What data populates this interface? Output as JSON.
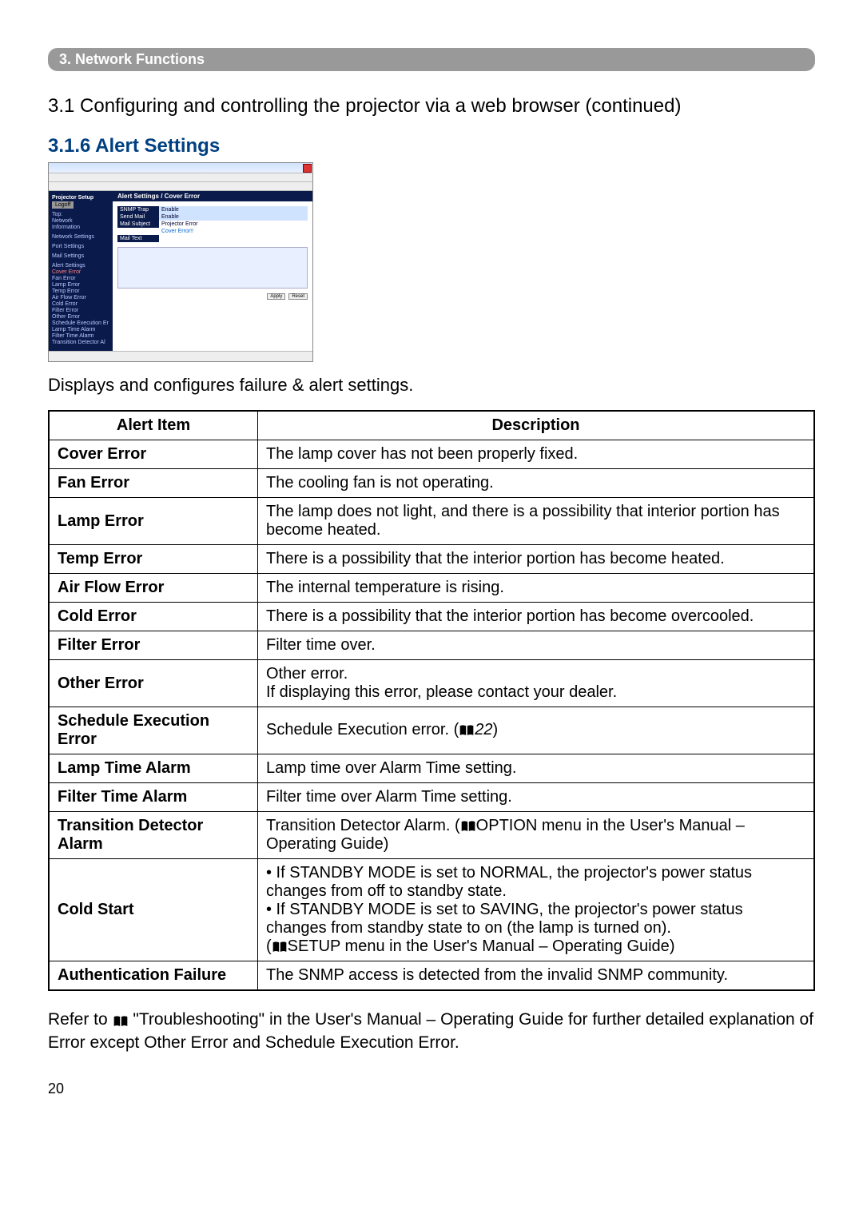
{
  "chapter_bar": "3. Network Functions",
  "section_title": "3.1 Conﬁguring and controlling the projector via a web browser (continued)",
  "heading": "3.1.6 Alert Settings",
  "screenshot": {
    "header": "Alert Settings / Cover Error",
    "side_top_label": "Projector Setup",
    "side_gray": "Logoff",
    "side_links": [
      "Top:",
      "Network",
      "Information",
      "",
      "Network Settings",
      "",
      "Port Settings",
      "",
      "Mail Settings",
      "",
      "Alert Settings"
    ],
    "side_alerts": [
      "Cover Error",
      "Fan Error",
      "Lamp Error",
      "Temp Error",
      "Air Flow Error",
      "Cold Error",
      "Filter Error",
      "Other Error",
      "Schedule Execution Er",
      "Lamp Time Alarm",
      "Filter Time Alarm",
      "Transition Detector Al"
    ],
    "row1": {
      "label": "SNMP Trap",
      "value": "Enable"
    },
    "row2": {
      "label": "Send Mail",
      "value": "Enable"
    },
    "row3": {
      "label": "Mail Subject",
      "value": "Projector Error"
    },
    "row4": {
      "label": "",
      "value": "Cover Error!!"
    },
    "row5": {
      "label": "Mail Text",
      "value": ""
    },
    "btn_apply": "Apply",
    "btn_reset": "Reset"
  },
  "intro": "Displays and configures failure & alert settings.",
  "table_headers": {
    "item": "Alert Item",
    "desc": "Description"
  },
  "rows": [
    {
      "item": "Cover Error",
      "desc": "The lamp cover has not been properly fixed."
    },
    {
      "item": "Fan Error",
      "desc": "The cooling fan is not operating."
    },
    {
      "item": "Lamp Error",
      "desc": "The lamp does not light, and there is a possibility that interior portion has become heated."
    },
    {
      "item": "Temp Error",
      "desc": "There is a possibility that the interior portion has become heated."
    },
    {
      "item": "Air Flow Error",
      "desc": "The internal temperature is rising."
    },
    {
      "item": "Cold Error",
      "desc": "There is a possibility that the interior portion has become overcooled."
    },
    {
      "item": "Filter Error",
      "desc": "Filter time over."
    },
    {
      "item": "Other Error",
      "desc_pre": "Other error.",
      "desc_post": "If displaying this error, please contact your dealer."
    },
    {
      "item": "Schedule Execution Error",
      "desc_pre": "Schedule Execution error. (",
      "ref": "22",
      "desc_post": ")"
    },
    {
      "item": "Lamp Time Alarm",
      "desc": "Lamp time over Alarm Time setting."
    },
    {
      "item": "Filter Time Alarm",
      "desc": "Filter time over Alarm Time setting."
    },
    {
      "item": "Transition Detector Alarm",
      "desc_pre": "Transition Detector Alarm. (",
      "ref": "OPTION menu in the User's Manual – Operating Guide",
      "desc_post": ")"
    },
    {
      "item": "Cold Start",
      "l1": "• If STANDBY MODE is set to NORMAL, the projector's power status changes from off to standby state.",
      "l2": "• If STANDBY MODE is set to SAVING, the projector's power status changes from standby state to on (the lamp is turned on).",
      "ref": "SETUP menu in the User's Manual – Operating Guide"
    },
    {
      "item": "Authentication Failure",
      "desc": "The SNMP access is detected from the invalid SNMP community."
    }
  ],
  "footer": {
    "pre": "Refer to ",
    "ref": "\"Troubleshooting\" in the User's Manual – Operating Guide",
    "post": " for further detailed explanation of Error except Other Error and Schedule Execution Error."
  },
  "page": "20"
}
